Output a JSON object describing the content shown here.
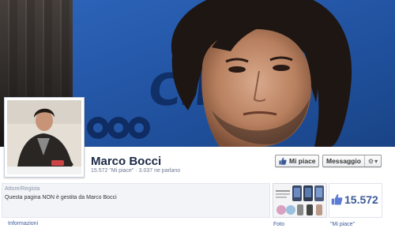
{
  "cover": {
    "text_fragment": "CIN",
    "colors": {
      "primary": "#2456a6",
      "dark": "#0f2d63"
    }
  },
  "page": {
    "name": "Marco Bocci",
    "stats": "15.572 \"Mi piace\" · 3.037 ne parlano"
  },
  "actions": {
    "like_label": "Mi piace",
    "message_label": "Messaggio",
    "gear_icon": "gear-icon",
    "caret": "▾"
  },
  "about": {
    "category": "Attore/Regista",
    "description": "Questa pagina NON è gestita da Marco Bocci"
  },
  "nav": {
    "info_label": "Informazioni"
  },
  "photo_tab": {
    "label": "Foto"
  },
  "likes_tab": {
    "count": "15.572",
    "label": "\"Mi piace\""
  },
  "colors": {
    "link": "#3b5998",
    "title": "#1c2a47"
  }
}
